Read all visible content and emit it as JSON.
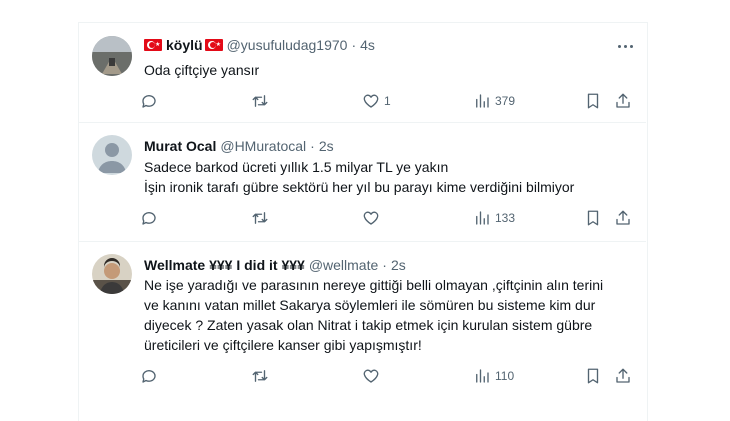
{
  "tweets": [
    {
      "name": "köylü",
      "name_flags": true,
      "handle": "@yusufuludag1970",
      "time": "4s",
      "lines": [
        "Oda çiftçiye yansır"
      ],
      "reply_count": "",
      "retweet_count": "",
      "like_count": "1",
      "view_count": "379",
      "avatar_icon": "landscape-photo-icon"
    },
    {
      "name": "Murat Ocal",
      "handle": "@HMuratocal",
      "time": "2s",
      "lines": [
        "Sadece barkod ücreti yıllık 1.5 milyar TL ye yakın",
        "İşin ironik tarafı gübre sektörü her yıl bu parayı kime verdiğini bilmiyor"
      ],
      "reply_count": "",
      "retweet_count": "",
      "like_count": "",
      "view_count": "133",
      "avatar_icon": "default-user-icon"
    },
    {
      "name": "Wellmate ¥¥¥ I did it ¥¥¥",
      "handle": "@wellmate",
      "time": "2s",
      "lines": [
        "Ne işe yaradığı ve parasının nereye gittiği belli olmayan ,çiftçinin alın terini",
        "ve kanını vatan millet Sakarya söylemleri ile sömüren bu sisteme kim dur",
        "diyecek ? Zaten yasak olan Nitrat i takip etmek için kurulan sistem gübre",
        "üreticileri ve çiftçilere kanser gibi yapışmıştır!"
      ],
      "reply_count": "",
      "retweet_count": "",
      "like_count": "",
      "view_count": "110",
      "avatar_icon": "person-photo-icon"
    }
  ],
  "colors": {
    "text": "#0f1419",
    "secondary": "#536471",
    "border": "#eff3f4",
    "flag_red": "#e30a17"
  }
}
